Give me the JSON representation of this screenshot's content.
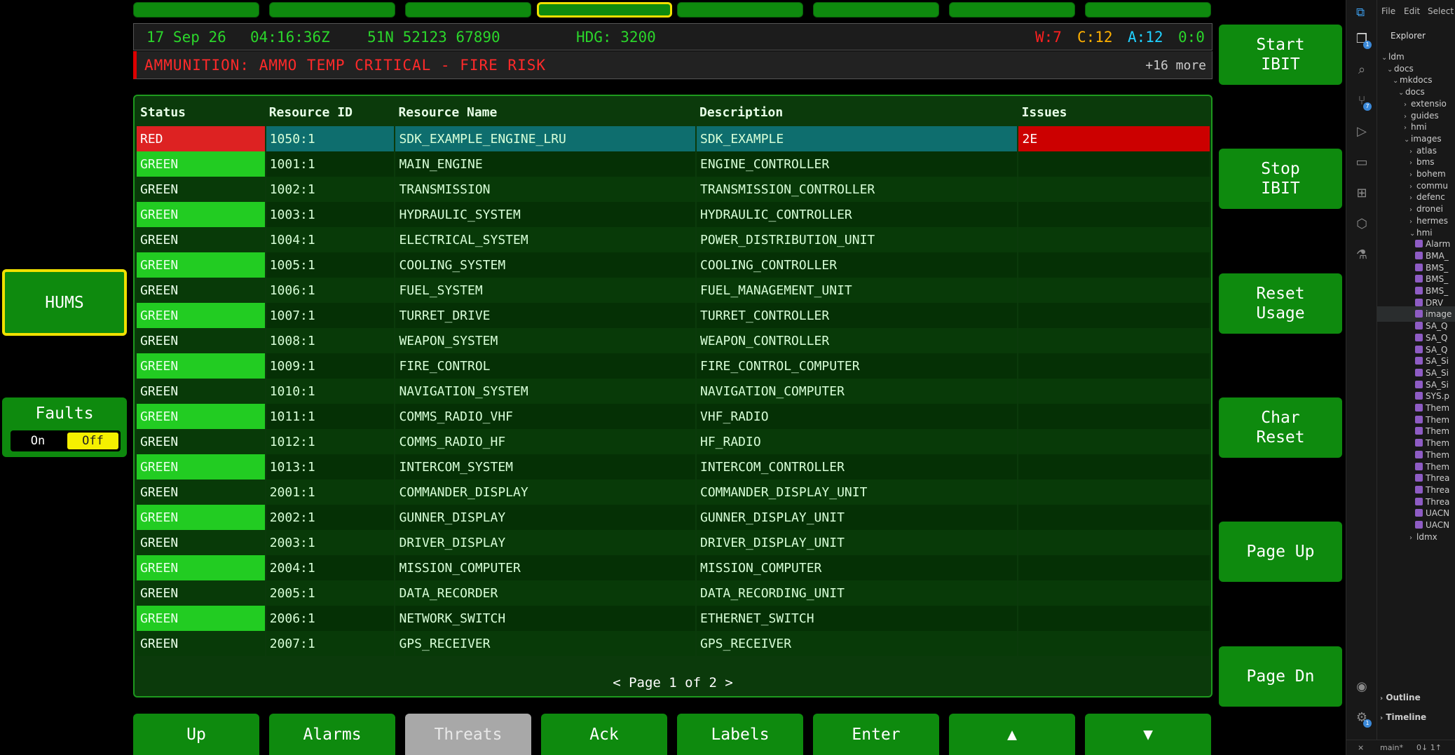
{
  "status": {
    "date": "17 Sep 26",
    "time": "04:16:36Z",
    "grid": "51N 52123 67890",
    "heading": "HDG: 3200",
    "counts": {
      "w": "W:7",
      "c": "C:12",
      "a": "A:12",
      "o": "0:0"
    }
  },
  "alarm": {
    "text": "AMMUNITION: AMMO TEMP CRITICAL - FIRE RISK",
    "more": "+16 more"
  },
  "table": {
    "headers": [
      "Status",
      "Resource ID",
      "Resource Name",
      "Description",
      "Issues"
    ],
    "rows": [
      {
        "status": "RED",
        "id": "1050:1",
        "name": "SDK_EXAMPLE_ENGINE_LRU",
        "desc": "SDK_EXAMPLE",
        "issues": "2E"
      },
      {
        "status": "GREEN",
        "id": "1001:1",
        "name": "MAIN_ENGINE",
        "desc": "ENGINE_CONTROLLER",
        "issues": ""
      },
      {
        "status": "GREEN",
        "id": "1002:1",
        "name": "TRANSMISSION",
        "desc": "TRANSMISSION_CONTROLLER",
        "issues": ""
      },
      {
        "status": "GREEN",
        "id": "1003:1",
        "name": "HYDRAULIC_SYSTEM",
        "desc": "HYDRAULIC_CONTROLLER",
        "issues": ""
      },
      {
        "status": "GREEN",
        "id": "1004:1",
        "name": "ELECTRICAL_SYSTEM",
        "desc": "POWER_DISTRIBUTION_UNIT",
        "issues": ""
      },
      {
        "status": "GREEN",
        "id": "1005:1",
        "name": "COOLING_SYSTEM",
        "desc": "COOLING_CONTROLLER",
        "issues": ""
      },
      {
        "status": "GREEN",
        "id": "1006:1",
        "name": "FUEL_SYSTEM",
        "desc": "FUEL_MANAGEMENT_UNIT",
        "issues": ""
      },
      {
        "status": "GREEN",
        "id": "1007:1",
        "name": "TURRET_DRIVE",
        "desc": "TURRET_CONTROLLER",
        "issues": ""
      },
      {
        "status": "GREEN",
        "id": "1008:1",
        "name": "WEAPON_SYSTEM",
        "desc": "WEAPON_CONTROLLER",
        "issues": ""
      },
      {
        "status": "GREEN",
        "id": "1009:1",
        "name": "FIRE_CONTROL",
        "desc": "FIRE_CONTROL_COMPUTER",
        "issues": ""
      },
      {
        "status": "GREEN",
        "id": "1010:1",
        "name": "NAVIGATION_SYSTEM",
        "desc": "NAVIGATION_COMPUTER",
        "issues": ""
      },
      {
        "status": "GREEN",
        "id": "1011:1",
        "name": "COMMS_RADIO_VHF",
        "desc": "VHF_RADIO",
        "issues": ""
      },
      {
        "status": "GREEN",
        "id": "1012:1",
        "name": "COMMS_RADIO_HF",
        "desc": "HF_RADIO",
        "issues": ""
      },
      {
        "status": "GREEN",
        "id": "1013:1",
        "name": "INTERCOM_SYSTEM",
        "desc": "INTERCOM_CONTROLLER",
        "issues": ""
      },
      {
        "status": "GREEN",
        "id": "2001:1",
        "name": "COMMANDER_DISPLAY",
        "desc": "COMMANDER_DISPLAY_UNIT",
        "issues": ""
      },
      {
        "status": "GREEN",
        "id": "2002:1",
        "name": "GUNNER_DISPLAY",
        "desc": "GUNNER_DISPLAY_UNIT",
        "issues": ""
      },
      {
        "status": "GREEN",
        "id": "2003:1",
        "name": "DRIVER_DISPLAY",
        "desc": "DRIVER_DISPLAY_UNIT",
        "issues": ""
      },
      {
        "status": "GREEN",
        "id": "2004:1",
        "name": "MISSION_COMPUTER",
        "desc": "MISSION_COMPUTER",
        "issues": ""
      },
      {
        "status": "GREEN",
        "id": "2005:1",
        "name": "DATA_RECORDER",
        "desc": "DATA_RECORDING_UNIT",
        "issues": ""
      },
      {
        "status": "GREEN",
        "id": "2006:1",
        "name": "NETWORK_SWITCH",
        "desc": "ETHERNET_SWITCH",
        "issues": ""
      },
      {
        "status": "GREEN",
        "id": "2007:1",
        "name": "GPS_RECEIVER",
        "desc": "GPS_RECEIVER",
        "issues": ""
      }
    ],
    "pager": "< Page 1 of 2 >"
  },
  "left_buttons": {
    "hums": "HUMS",
    "faults": "Faults",
    "on": "On",
    "off": "Off"
  },
  "right_buttons": {
    "start_ibit": "Start\nIBIT",
    "stop_ibit": "Stop\nIBIT",
    "reset_usage": "Reset\nUsage",
    "char_reset": "Char\nReset",
    "page_up": "Page Up",
    "page_dn": "Page Dn"
  },
  "bottom_buttons": [
    "Up",
    "Alarms",
    "Threats",
    "Ack",
    "Labels",
    "Enter",
    "▲",
    "▼"
  ],
  "colors": {
    "button_green": "#0e8a0e",
    "status_green": "#22cc22",
    "status_red": "#dd2222",
    "highlight_yellow": "#f0e000",
    "alarm_red": "#ff2a2a",
    "warn_count": "#ff2020",
    "caution_count": "#ffb000",
    "advisory_count": "#20d0ff"
  },
  "editor": {
    "menu": [
      "File",
      "Edit",
      "Select"
    ],
    "explorer_title": "Explorer",
    "tree": [
      {
        "label": "ldm",
        "depth": 0,
        "type": "folder-open"
      },
      {
        "label": "docs",
        "depth": 1,
        "type": "folder-open"
      },
      {
        "label": "mkdocs",
        "depth": 2,
        "type": "folder-open"
      },
      {
        "label": "docs",
        "depth": 3,
        "type": "folder-open"
      },
      {
        "label": "extensio",
        "depth": 4,
        "type": "folder"
      },
      {
        "label": "guides",
        "depth": 4,
        "type": "folder"
      },
      {
        "label": "hmi",
        "depth": 4,
        "type": "folder"
      },
      {
        "label": "images",
        "depth": 4,
        "type": "folder-open"
      },
      {
        "label": "atlas",
        "depth": 5,
        "type": "folder"
      },
      {
        "label": "bms",
        "depth": 5,
        "type": "folder"
      },
      {
        "label": "bohem",
        "depth": 5,
        "type": "folder"
      },
      {
        "label": "commu",
        "depth": 5,
        "type": "folder"
      },
      {
        "label": "defenc",
        "depth": 5,
        "type": "folder"
      },
      {
        "label": "dronei",
        "depth": 5,
        "type": "folder"
      },
      {
        "label": "hermes",
        "depth": 5,
        "type": "folder"
      },
      {
        "label": "hmi",
        "depth": 5,
        "type": "folder-open"
      },
      {
        "label": "Alarm",
        "depth": 6,
        "type": "file"
      },
      {
        "label": "BMA_",
        "depth": 6,
        "type": "file"
      },
      {
        "label": "BMS_",
        "depth": 6,
        "type": "file"
      },
      {
        "label": "BMS_",
        "depth": 6,
        "type": "file"
      },
      {
        "label": "BMS_",
        "depth": 6,
        "type": "file"
      },
      {
        "label": "DRV_",
        "depth": 6,
        "type": "file"
      },
      {
        "label": "image",
        "depth": 6,
        "type": "file",
        "selected": true
      },
      {
        "label": "SA_Q",
        "depth": 6,
        "type": "file"
      },
      {
        "label": "SA_Q",
        "depth": 6,
        "type": "file"
      },
      {
        "label": "SA_Q",
        "depth": 6,
        "type": "file"
      },
      {
        "label": "SA_Si",
        "depth": 6,
        "type": "file"
      },
      {
        "label": "SA_Si",
        "depth": 6,
        "type": "file"
      },
      {
        "label": "SA_Si",
        "depth": 6,
        "type": "file"
      },
      {
        "label": "SYS.p",
        "depth": 6,
        "type": "file"
      },
      {
        "label": "Them",
        "depth": 6,
        "type": "file"
      },
      {
        "label": "Them",
        "depth": 6,
        "type": "file"
      },
      {
        "label": "Them",
        "depth": 6,
        "type": "file"
      },
      {
        "label": "Them",
        "depth": 6,
        "type": "file"
      },
      {
        "label": "Them",
        "depth": 6,
        "type": "file"
      },
      {
        "label": "Them",
        "depth": 6,
        "type": "file"
      },
      {
        "label": "Threa",
        "depth": 6,
        "type": "file"
      },
      {
        "label": "Threa",
        "depth": 6,
        "type": "file"
      },
      {
        "label": "Threa",
        "depth": 6,
        "type": "file"
      },
      {
        "label": "UACN",
        "depth": 6,
        "type": "file"
      },
      {
        "label": "UACN",
        "depth": 6,
        "type": "file"
      },
      {
        "label": "ldmx",
        "depth": 5,
        "type": "folder"
      }
    ],
    "outline": "Outline",
    "timeline": "Timeline",
    "branch": "main*",
    "sync": "0↓ 1↑"
  }
}
